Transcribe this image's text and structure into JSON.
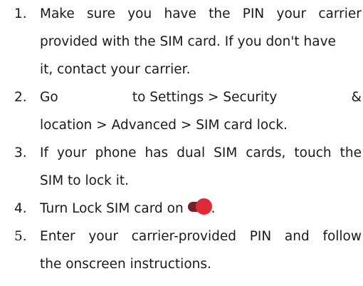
{
  "steps": [
    {
      "number": "1.",
      "lines": [
        "Make sure you have the PIN your carrier",
        "provided with the SIM card. If you don't have",
        "it, contact your carrier."
      ]
    },
    {
      "number": "2.",
      "line1_parts": [
        "Go",
        "to Settings > Security",
        "&"
      ],
      "line2": "location > Advanced > SIM card lock."
    },
    {
      "number": "3.",
      "lines": [
        "If your phone has dual SIM cards, touch the",
        "SIM to lock it."
      ]
    },
    {
      "number": "4.",
      "text": "Turn Lock SIM card on",
      "suffix": "."
    },
    {
      "number": "5.",
      "lines": [
        "Enter your carrier-provided PIN and follow",
        "the onscreen instructions."
      ]
    }
  ],
  "toggle": {
    "state": "on",
    "track_color": "#7a1d24",
    "knob_color": "#e12a37",
    "icon": "toggle-switch-icon"
  }
}
